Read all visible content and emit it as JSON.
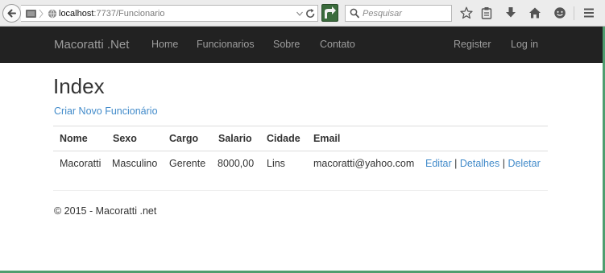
{
  "browser": {
    "url_host": "localhost",
    "url_path": ":7737/Funcionario",
    "search_placeholder": "Pesquisar"
  },
  "navbar": {
    "brand": "Macoratti .Net",
    "links": [
      "Home",
      "Funcionarios",
      "Sobre",
      "Contato"
    ],
    "right_links": [
      "Register",
      "Log in"
    ]
  },
  "page": {
    "title": "Index",
    "create_link": "Criar Novo Funcionário"
  },
  "table": {
    "headers": [
      "Nome",
      "Sexo",
      "Cargo",
      "Salario",
      "Cidade",
      "Email"
    ],
    "rows": [
      {
        "cells": [
          "Macoratti",
          "Masculino",
          "Gerente",
          "8000,00",
          "Lins",
          "macoratti@yahoo.com"
        ],
        "actions": [
          "Editar",
          "Detalhes",
          "Deletar"
        ],
        "separator": "|"
      }
    ]
  },
  "footer": {
    "text": "© 2015 - Macoratti .net"
  },
  "colors": {
    "navbar_bg": "#222222",
    "nav_text": "#9d9d9d",
    "link": "#428bca",
    "window_frame": "#4f9d6f"
  },
  "icons": {
    "back": "back-arrow-icon",
    "identity": "page-identity-icon",
    "globe": "globe-icon",
    "dropdown": "chevron-down-icon",
    "reload": "reload-icon",
    "addon": "addon-icon",
    "search": "search-icon",
    "bookmark_star": "star-icon",
    "reading_list": "clipboard-icon",
    "downloads": "download-arrow-icon",
    "home": "home-icon",
    "chat": "chat-icon",
    "menu": "hamburger-menu-icon"
  }
}
